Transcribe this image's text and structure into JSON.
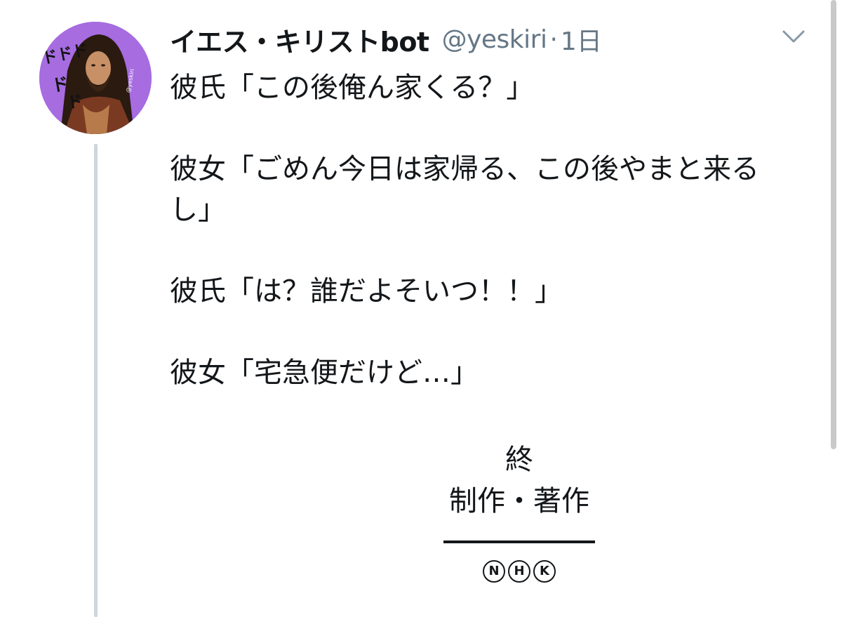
{
  "tweet": {
    "display_name": "イエス・キリストbot",
    "handle": "@yeskiri",
    "separator": "·",
    "timestamp": "1日",
    "avatar_watermark": "@yeskiri",
    "avatar_sfx": "ドドド",
    "paragraphs": [
      "彼氏「この後俺ん家くる？」",
      "彼女「ごめん今日は家帰る、この後やまと来るし」",
      "彼氏「は？誰だよそいつ！！」",
      "彼女「宅急便だけど…」"
    ],
    "end_mark": "終",
    "credit": "制作・著作",
    "broadcaster_letters": [
      "N",
      "H",
      "K"
    ]
  },
  "icons": {
    "more_menu": "chevron-down-icon"
  },
  "colors": {
    "avatar_bg": "#a66ce0",
    "thread_line": "#ccd6dd",
    "muted_text": "#657786",
    "text": "#14171a"
  }
}
